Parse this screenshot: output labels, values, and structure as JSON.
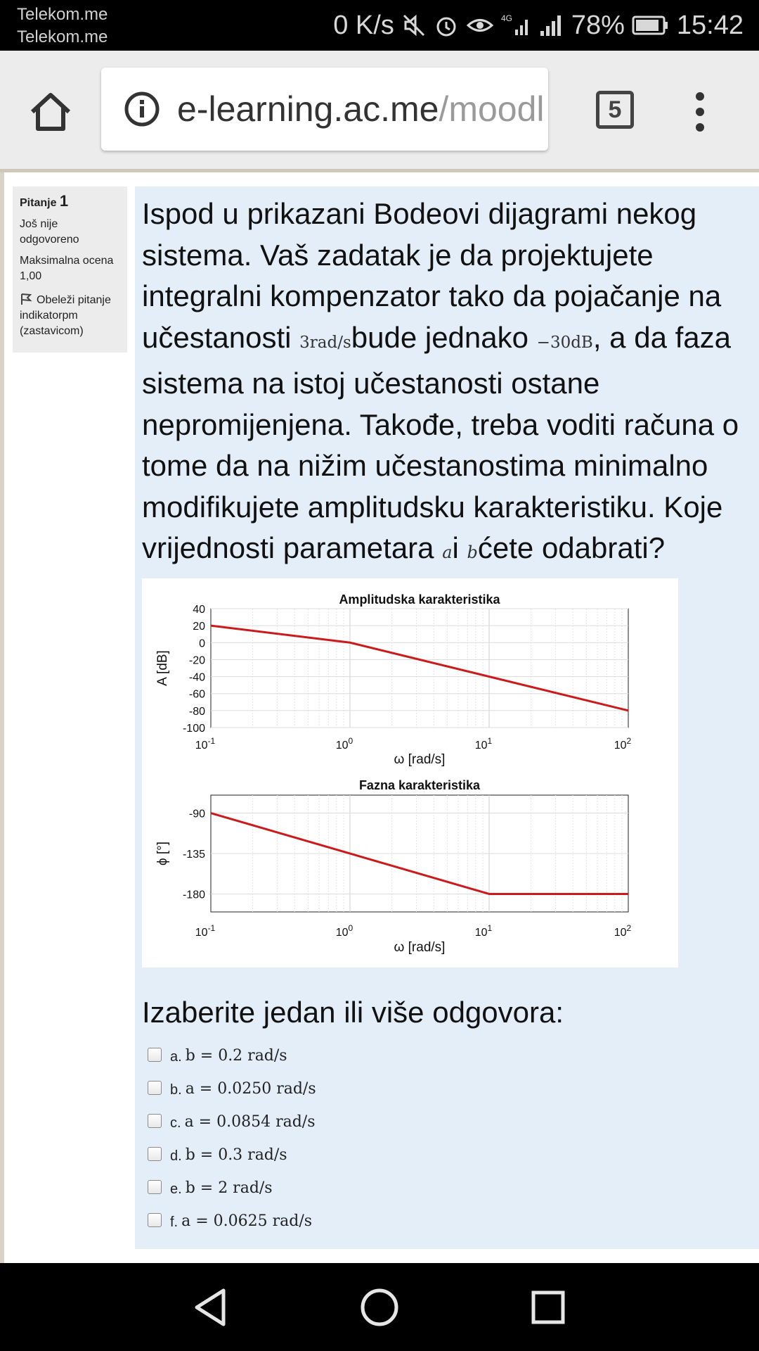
{
  "status_bar": {
    "carrier_1": "Telekom.me",
    "carrier_2": "Telekom.me",
    "speed": "0 K/s",
    "battery": "78%",
    "time": "15:42"
  },
  "browser": {
    "url_host": "e-learning.ac.me",
    "url_path": "/moodl",
    "tab_count": "5"
  },
  "question_info": {
    "label": "Pitanje",
    "number": "1",
    "status": "Još nije odgovoreno",
    "max_grade_label": "Maksimalna ocena",
    "max_grade": "1,00",
    "flag_text": "Obeleži pitanje indikatorpm (zastavicom)"
  },
  "question": {
    "t1": "Ispod u prikazani Bodeovi dijagrami nekog sistema. Vaš zadatak je da projektujete integralni kompenzator tako da pojačanje na učestanosti ",
    "m1": "3rad/s",
    "t2": "bude jednako ",
    "m2": "−30dB",
    "t3": ", a da faza sistema na istoj učestanosti ostane nepromijenjena. Takođe, treba voditi računa o tome da na nižim učestanostima minimalno modifikujete amplitudsku karakteristiku. Koje vrijednosti parametara ",
    "m3": "a",
    "t4": "i ",
    "m4": "b",
    "t5": "ćete odabrati?"
  },
  "answer_prompt": "Izaberite jedan ili više odgovora:",
  "options": [
    {
      "letter": "a.",
      "math": "b = 0.2 rad/s"
    },
    {
      "letter": "b.",
      "math": "a = 0.0250 rad/s"
    },
    {
      "letter": "c.",
      "math": "a = 0.0854 rad/s"
    },
    {
      "letter": "d.",
      "math": "b = 0.3 rad/s"
    },
    {
      "letter": "e.",
      "math": "b = 2 rad/s"
    },
    {
      "letter": "f.",
      "math": "a = 0.0625 rad/s"
    }
  ],
  "chart_data": [
    {
      "type": "line",
      "title": "Amplitudska karakteristika",
      "xlabel": "ω [rad/s]",
      "ylabel": "A [dB]",
      "xscale": "log",
      "xlim": [
        0.1,
        100
      ],
      "ylim": [
        -100,
        40
      ],
      "yticks": [
        "40",
        "20",
        "0",
        "-20",
        "-40",
        "-60",
        "-80",
        "-100"
      ],
      "xticks": [
        "10-1",
        "100",
        "101",
        "102"
      ],
      "grid": true,
      "color": "#cc1a1a",
      "x": [
        0.1,
        1,
        100
      ],
      "y": [
        20,
        0,
        -80
      ]
    },
    {
      "type": "line",
      "title": "Fazna karakteristika",
      "xlabel": "ω [rad/s]",
      "ylabel": "ϕ [°]",
      "xscale": "log",
      "xlim": [
        0.1,
        100
      ],
      "ylim": [
        -200,
        -70
      ],
      "yticks": [
        "-90",
        "-135",
        "-180"
      ],
      "xticks": [
        "10-1",
        "100",
        "101",
        "102"
      ],
      "grid": true,
      "color": "#cc1a1a",
      "x": [
        0.1,
        10,
        100
      ],
      "y": [
        -90,
        -180,
        -180
      ]
    }
  ]
}
